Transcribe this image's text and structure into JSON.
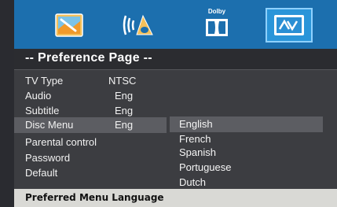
{
  "icons": [
    {
      "name": "general-setup-icon"
    },
    {
      "name": "audio-setup-icon"
    },
    {
      "name": "dolby-setup-icon",
      "label": "Dolby"
    },
    {
      "name": "preference-setup-icon"
    }
  ],
  "page": {
    "title": "-- Preference Page --"
  },
  "menu": {
    "items": [
      {
        "label": "TV Type",
        "value": "NTSC"
      },
      {
        "label": "Audio",
        "value": "Eng"
      },
      {
        "label": "Subtitle",
        "value": "Eng"
      },
      {
        "label": "Disc Menu",
        "value": "Eng"
      },
      {
        "label": "Parental control",
        "value": ""
      },
      {
        "label": "Password",
        "value": ""
      },
      {
        "label": "Default",
        "value": ""
      }
    ],
    "selected_index": 3
  },
  "options": {
    "items": [
      "English",
      "French",
      "Spanish",
      "Portuguese",
      "Dutch"
    ],
    "selected_index": 0
  },
  "footer": {
    "text": "Preferred Menu Language"
  },
  "colors": {
    "icon_bar": "#1c6fae",
    "panel": "#3c3d41",
    "highlight": "#5c5d62",
    "footer": "#d9d9d5"
  }
}
